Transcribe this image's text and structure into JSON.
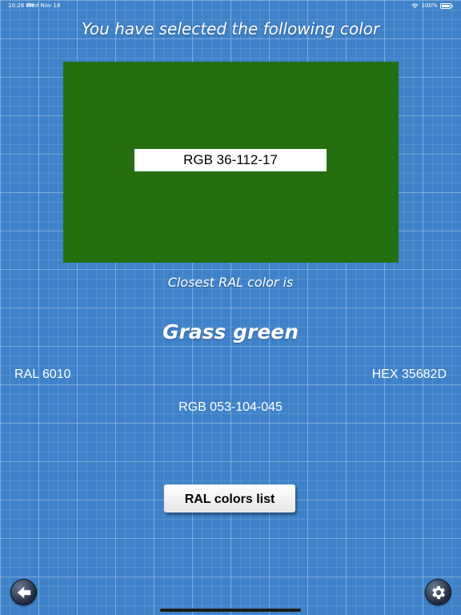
{
  "status_bar": {
    "time": "10:28 PM",
    "date": "Wed Nov 18",
    "battery": "100%"
  },
  "heading": "You have selected the following color",
  "selected_color": {
    "swatch_hex": "#247011",
    "rgb_label": "RGB 36-112-17"
  },
  "closest_label": "Closest RAL color is",
  "result": {
    "name": "Grass green",
    "ral": "RAL 6010",
    "hex": "HEX 35682D",
    "rgb": "RGB 053-104-045"
  },
  "buttons": {
    "ral_list": "RAL colors list",
    "back_icon": "arrow-left-icon",
    "settings_icon": "gear-icon"
  },
  "colors": {
    "background": "#3f82c9",
    "text": "#ffffff"
  }
}
